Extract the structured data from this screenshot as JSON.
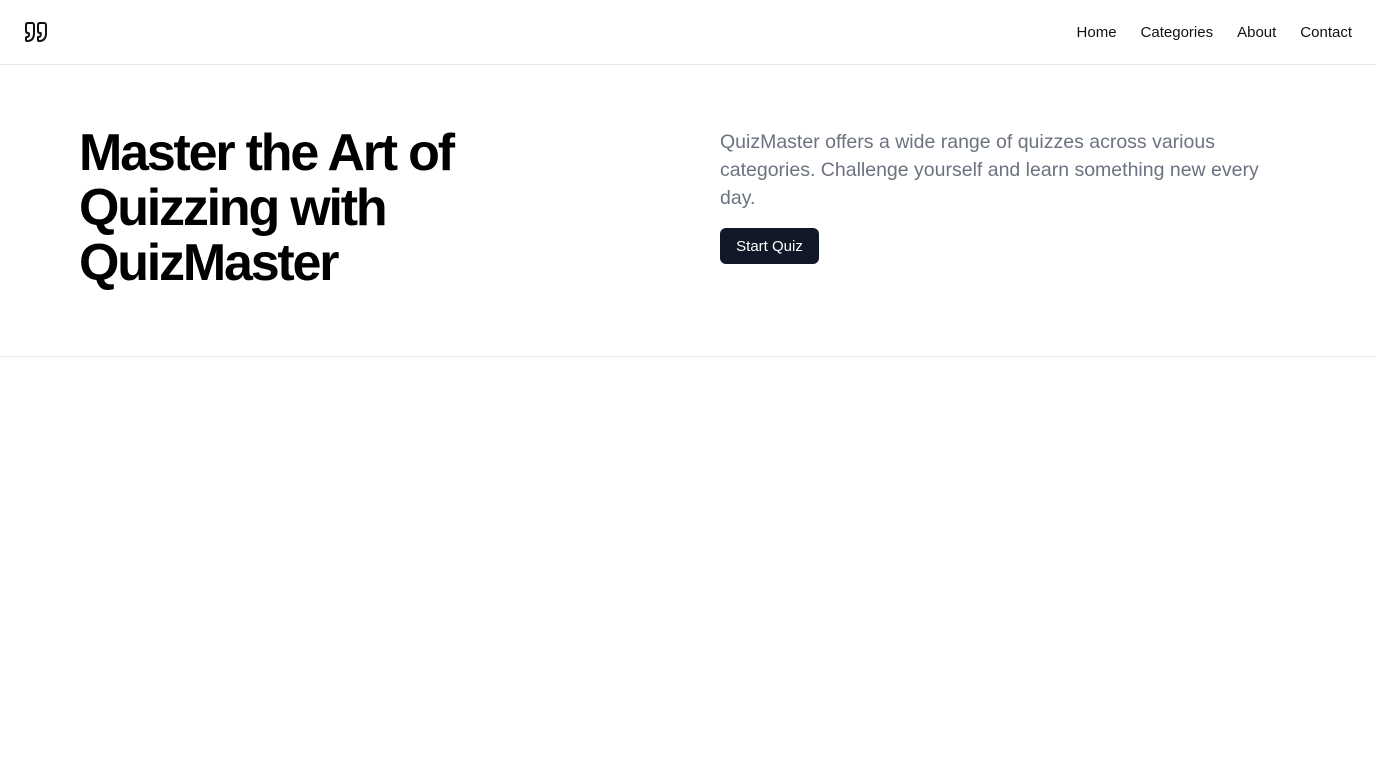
{
  "header": {
    "logo_icon": "quote-icon",
    "nav": [
      {
        "label": "Home"
      },
      {
        "label": "Categories"
      },
      {
        "label": "About"
      },
      {
        "label": "Contact"
      }
    ]
  },
  "hero": {
    "title": "Master the Art of Quizzing with QuizMaster",
    "description": "QuizMaster offers a wide range of quizzes across various categories. Challenge yourself and learn something new every day.",
    "cta_label": "Start Quiz"
  },
  "colors": {
    "button_bg": "#111827",
    "description_text": "#6b7280",
    "divider": "#e5e7eb"
  }
}
